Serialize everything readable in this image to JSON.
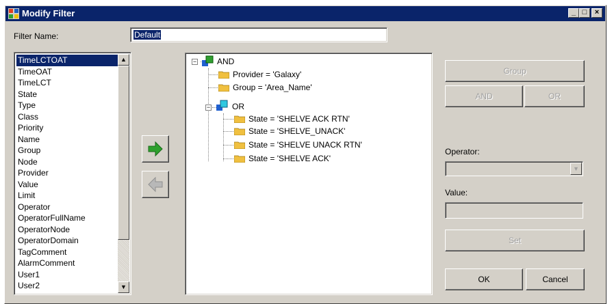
{
  "window": {
    "title": "Modify Filter",
    "min": "_",
    "max": "□",
    "close": "×"
  },
  "filter_name": {
    "label": "Filter Name:",
    "value": "Default"
  },
  "fields": [
    "TimeLCTOAT",
    "TimeOAT",
    "TimeLCT",
    "State",
    "Type",
    "Class",
    "Priority",
    "Name",
    "Group",
    "Node",
    "Provider",
    "Value",
    "Limit",
    "Operator",
    "OperatorFullName",
    "OperatorNode",
    "OperatorDomain",
    "TagComment",
    "AlarmComment",
    "User1",
    "User2"
  ],
  "selected_field": "TimeLCTOAT",
  "tree": {
    "root": "AND",
    "items": [
      {
        "text": "Provider = 'Galaxy'"
      },
      {
        "text": "Group = 'Area_Name'"
      }
    ],
    "or_node": "OR",
    "or_items": [
      {
        "text": "State = 'SHELVE ACK RTN'"
      },
      {
        "text": "State = 'SHELVE_UNACK'"
      },
      {
        "text": "State = 'SHELVE UNACK RTN'"
      },
      {
        "text": "State = 'SHELVE ACK'"
      }
    ]
  },
  "buttons": {
    "group": "Group",
    "and": "AND",
    "or": "OR",
    "set": "Set",
    "ok": "OK",
    "cancel": "Cancel"
  },
  "operator": {
    "label": "Operator:",
    "value": ""
  },
  "value": {
    "label": "Value:",
    "value": ""
  },
  "colors": {
    "titlebar": "#0a246a",
    "face": "#d4d0c8",
    "arrow_active": "#2ea02e",
    "arrow_disabled": "#a8a8a8",
    "folder": "#f0c040"
  }
}
